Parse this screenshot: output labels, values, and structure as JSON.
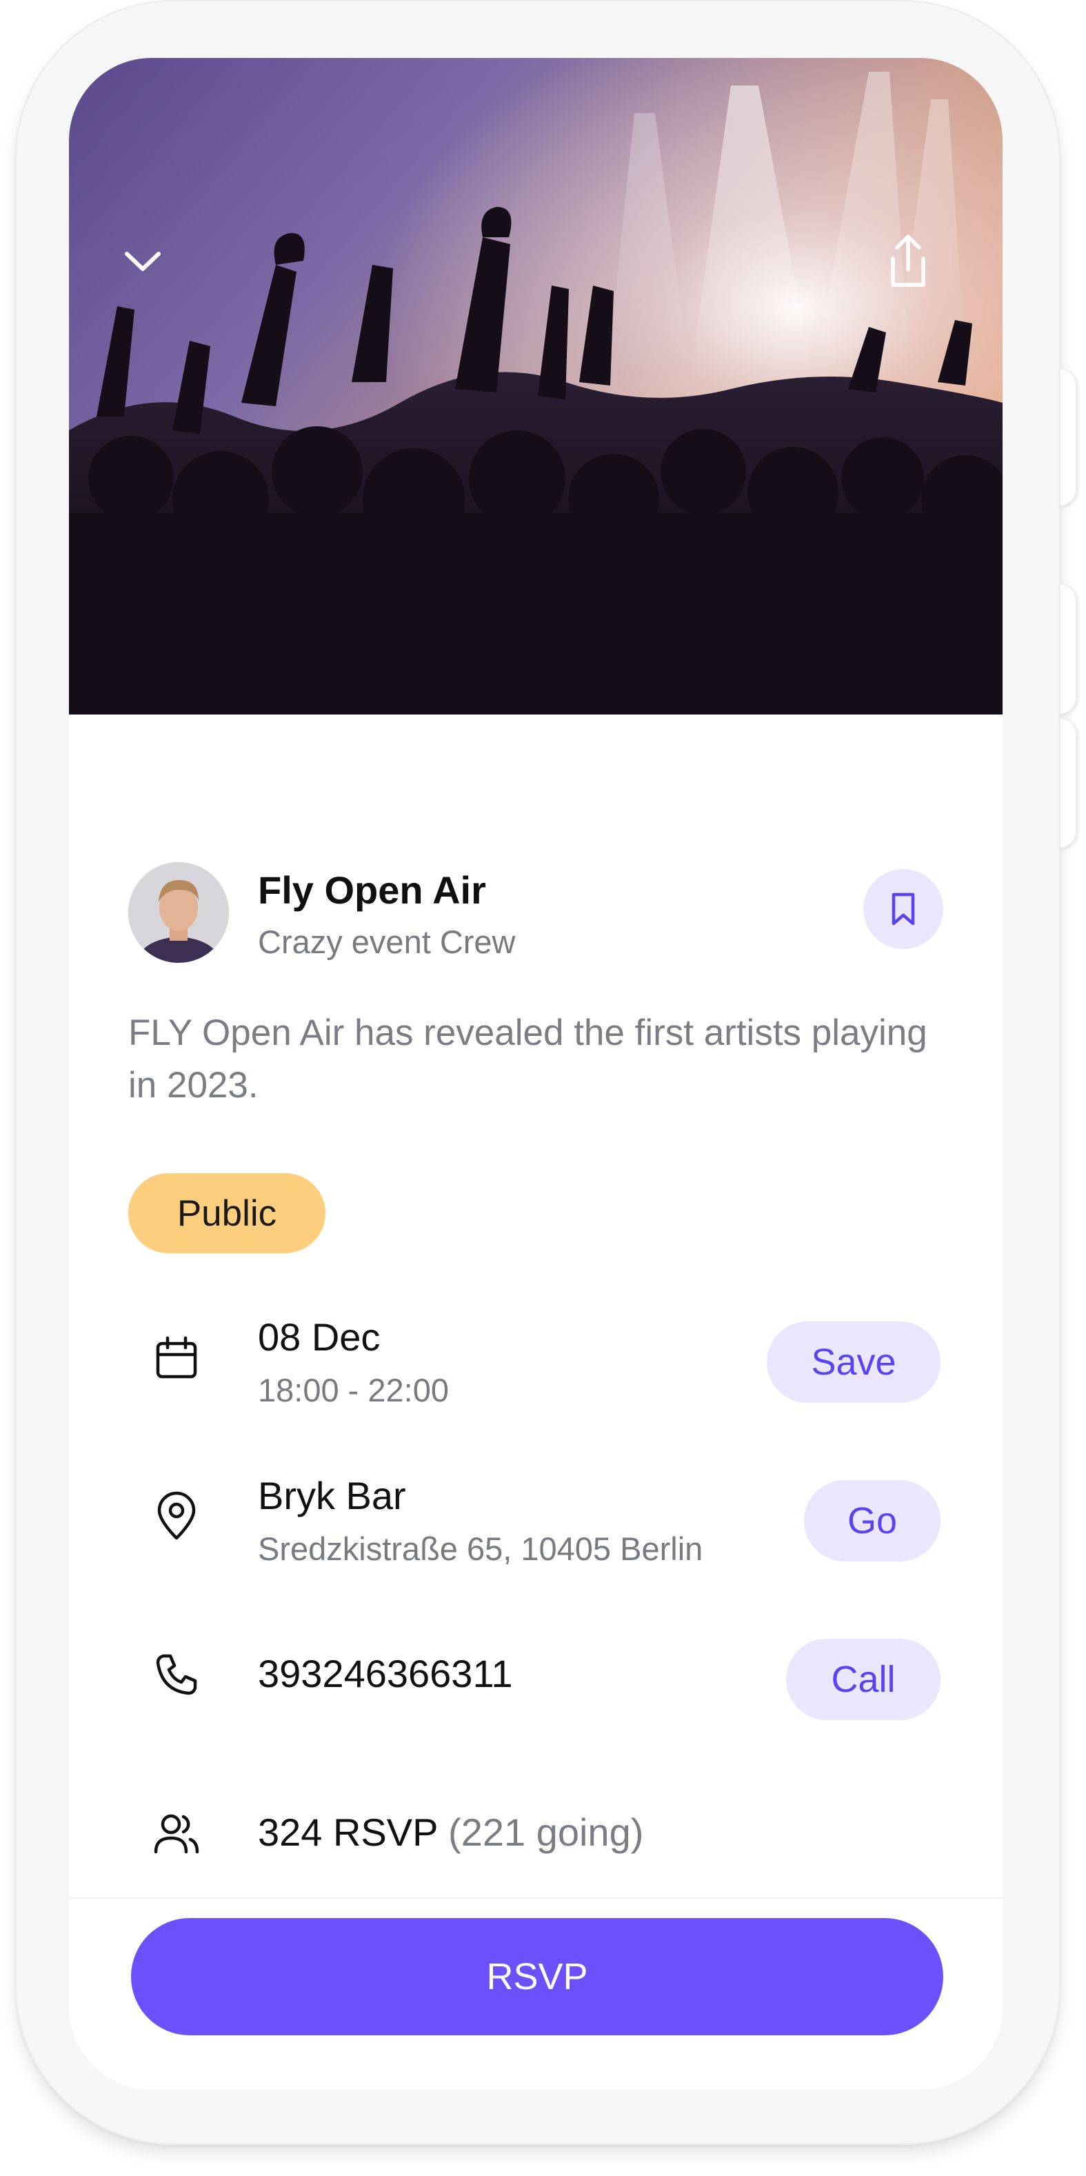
{
  "organizer": {
    "name": "Fly Open Air",
    "crew": "Crazy event Crew"
  },
  "event": {
    "description": "FLY Open Air has revealed the first artists playing in 2023.",
    "visibility_badge": "Public"
  },
  "details": {
    "date": {
      "title": "08 Dec",
      "subtitle": "18:00 - 22:00",
      "action": "Save"
    },
    "location": {
      "title": "Bryk Bar",
      "subtitle": "Sredzkistraße 65, 10405 Berlin",
      "action": "Go"
    },
    "phone": {
      "title": "393246366311",
      "action": "Call"
    },
    "rsvp": {
      "count": "324 RSVP",
      "going": "(221 going)"
    }
  },
  "primary_action": {
    "label": "RSVP"
  },
  "colors": {
    "accent": "#6b50fb",
    "accent_soft": "#e9e6fd",
    "badge": "#fdce7e",
    "muted_text": "#777a80"
  },
  "icons": {
    "collapse": "chevron-down-icon",
    "share": "share-icon",
    "bookmark": "bookmark-icon",
    "date": "calendar-icon",
    "location": "map-pin-icon",
    "phone": "phone-icon",
    "attendees": "users-icon"
  }
}
